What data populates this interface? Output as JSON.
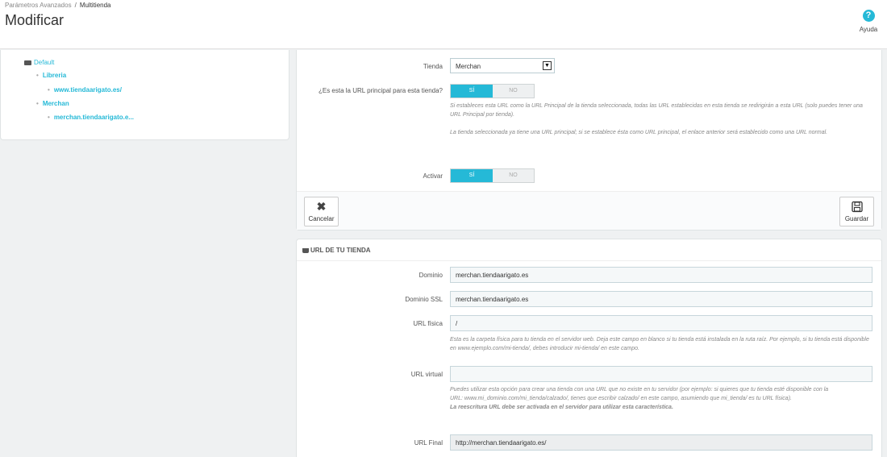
{
  "breadcrumb": {
    "parent": "Parámetros Avanzados",
    "separator": "/",
    "current": "Multitienda"
  },
  "page": {
    "title": "Modificar"
  },
  "help": {
    "label": "Ayuda",
    "icon": "question-icon"
  },
  "tree": {
    "root": "Default",
    "items": [
      {
        "label": "Libreria"
      },
      {
        "label": "www.tiendaarigato.es/"
      },
      {
        "label": "Merchan"
      },
      {
        "label": "merchan.tiendaarigato.e..."
      }
    ]
  },
  "form": {
    "tienda_label": "Tienda",
    "tienda_value": "Merchan",
    "principal_label": "¿Es esta la URL principal para esta tienda?",
    "switch_yes": "SÍ",
    "switch_no": "NO",
    "principal_help_1": "Si estableces esta URL como la URL Principal de la tienda seleccionada, todas las URL establecidas en esta tienda se redirigirán a esta URL (solo puedes tener una URL Principal por tienda).",
    "principal_help_2": "La tienda seleccionada ya tiene una URL principal; si se establece ésta como URL principal, el enlace anterior será establecido como una URL normal.",
    "activar_label": "Activar",
    "cancel_label": "Cancelar",
    "save_label": "Guardar"
  },
  "url_panel": {
    "heading": "URL DE TU TIENDA",
    "dominio_label": "Dominio",
    "dominio_value": "merchan.tiendaarigato.es",
    "ssl_label": "Dominio SSL",
    "ssl_value": "merchan.tiendaarigato.es",
    "fisica_label": "URL física",
    "fisica_value": "/",
    "fisica_help": "Esta es la carpeta física para tu tienda en el servidor web. Deja este campo en blanco si tu tienda está instalada en la ruta raíz. Por ejemplo, si tu tienda está disponible en www.ejemplo.com/mi-tienda/, debes introducir mi-tienda/ en este campo.",
    "virtual_label": "URL virtual",
    "virtual_value": "",
    "virtual_help": "Puedes utilizar esta opción para crear una tienda con una URL que no existe en tu servidor (por ejemplo: si quieres que tu tienda esté disponible con la URL: www.mi_dominio.com/mi_tienda/calzado/, tienes que escribir calzado/ en este campo, asumiendo que mi_tienda/ es tu URL física).",
    "virtual_help_bold": "La reescritura URL debe ser activada en el servidor para utilizar esta característica.",
    "final_label": "URL Final",
    "final_value": "http://merchan.tiendaarigato.es/"
  },
  "colors": {
    "accent": "#25b9d7",
    "background": "#eff1f2"
  }
}
